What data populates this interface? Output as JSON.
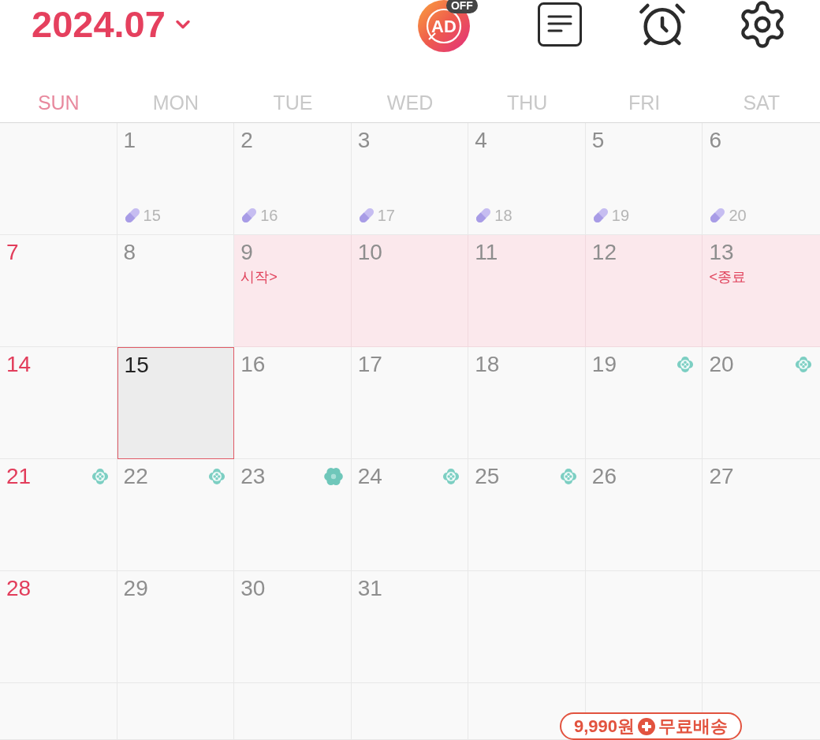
{
  "header": {
    "title": "2024.07",
    "ad_button": {
      "label": "AD",
      "badge": "OFF"
    }
  },
  "weekdays": [
    {
      "label": "SUN",
      "kind": "sunday"
    },
    {
      "label": "MON",
      "kind": "weekday"
    },
    {
      "label": "TUE",
      "kind": "weekday"
    },
    {
      "label": "WED",
      "kind": "weekday"
    },
    {
      "label": "THU",
      "kind": "weekday"
    },
    {
      "label": "FRI",
      "kind": "weekday"
    },
    {
      "label": "SAT",
      "kind": "weekday"
    }
  ],
  "weeks": [
    {
      "days": [
        {
          "kind": "blank"
        },
        {
          "kind": "day",
          "day": "1",
          "selected": false,
          "period": false,
          "pill": "15"
        },
        {
          "kind": "day",
          "day": "2",
          "selected": false,
          "period": false,
          "pill": "16"
        },
        {
          "kind": "day",
          "day": "3",
          "selected": false,
          "period": false,
          "pill": "17"
        },
        {
          "kind": "day",
          "day": "4",
          "selected": false,
          "period": false,
          "pill": "18"
        },
        {
          "kind": "day",
          "day": "5",
          "selected": false,
          "period": false,
          "pill": "19"
        },
        {
          "kind": "day",
          "day": "6",
          "selected": false,
          "period": false,
          "pill": "20"
        }
      ]
    },
    {
      "days": [
        {
          "kind": "day",
          "day": "7",
          "selected": false,
          "period": false
        },
        {
          "kind": "day",
          "day": "8",
          "selected": false,
          "period": false
        },
        {
          "kind": "day",
          "day": "9",
          "selected": false,
          "period": true,
          "note": "시작>"
        },
        {
          "kind": "day",
          "day": "10",
          "selected": false,
          "period": true
        },
        {
          "kind": "day",
          "day": "11",
          "selected": false,
          "period": true
        },
        {
          "kind": "day",
          "day": "12",
          "selected": false,
          "period": true
        },
        {
          "kind": "day",
          "day": "13",
          "selected": false,
          "period": true,
          "note": "<종료"
        }
      ]
    },
    {
      "days": [
        {
          "kind": "day",
          "day": "14",
          "selected": false,
          "period": false
        },
        {
          "kind": "day",
          "day": "15",
          "selected": true,
          "period": false
        },
        {
          "kind": "day",
          "day": "16",
          "selected": false,
          "period": false
        },
        {
          "kind": "day",
          "day": "17",
          "selected": false,
          "period": false
        },
        {
          "kind": "day",
          "day": "18",
          "selected": false,
          "period": false
        },
        {
          "kind": "day",
          "day": "19",
          "selected": false,
          "period": false,
          "marker": {
            "kind": "ring_flower"
          }
        },
        {
          "kind": "day",
          "day": "20",
          "selected": false,
          "period": false,
          "marker": {
            "kind": "ring_flower"
          }
        }
      ]
    },
    {
      "days": [
        {
          "kind": "day",
          "day": "21",
          "selected": false,
          "period": false,
          "marker": {
            "kind": "ring_flower"
          }
        },
        {
          "kind": "day",
          "day": "22",
          "selected": false,
          "period": false,
          "marker": {
            "kind": "ring_flower"
          }
        },
        {
          "kind": "day",
          "day": "23",
          "selected": false,
          "period": false,
          "marker": {
            "kind": "solid_flower"
          }
        },
        {
          "kind": "day",
          "day": "24",
          "selected": false,
          "period": false,
          "marker": {
            "kind": "ring_flower"
          }
        },
        {
          "kind": "day",
          "day": "25",
          "selected": false,
          "period": false,
          "marker": {
            "kind": "ring_flower"
          }
        },
        {
          "kind": "day",
          "day": "26",
          "selected": false,
          "period": false
        },
        {
          "kind": "day",
          "day": "27",
          "selected": false,
          "period": false
        }
      ]
    },
    {
      "days": [
        {
          "kind": "day",
          "day": "28",
          "selected": false,
          "period": false
        },
        {
          "kind": "day",
          "day": "29",
          "selected": false,
          "period": false
        },
        {
          "kind": "day",
          "day": "30",
          "selected": false,
          "period": false
        },
        {
          "kind": "day",
          "day": "31",
          "selected": false,
          "period": false
        },
        {
          "kind": "blank"
        },
        {
          "kind": "blank"
        },
        {
          "kind": "blank"
        }
      ]
    },
    {
      "days": [
        {
          "kind": "blank"
        },
        {
          "kind": "blank"
        },
        {
          "kind": "blank"
        },
        {
          "kind": "blank"
        },
        {
          "kind": "blank"
        },
        {
          "kind": "blank"
        },
        {
          "kind": "blank"
        }
      ]
    }
  ],
  "promo": {
    "price": "9,990원",
    "label": "무료배송"
  }
}
